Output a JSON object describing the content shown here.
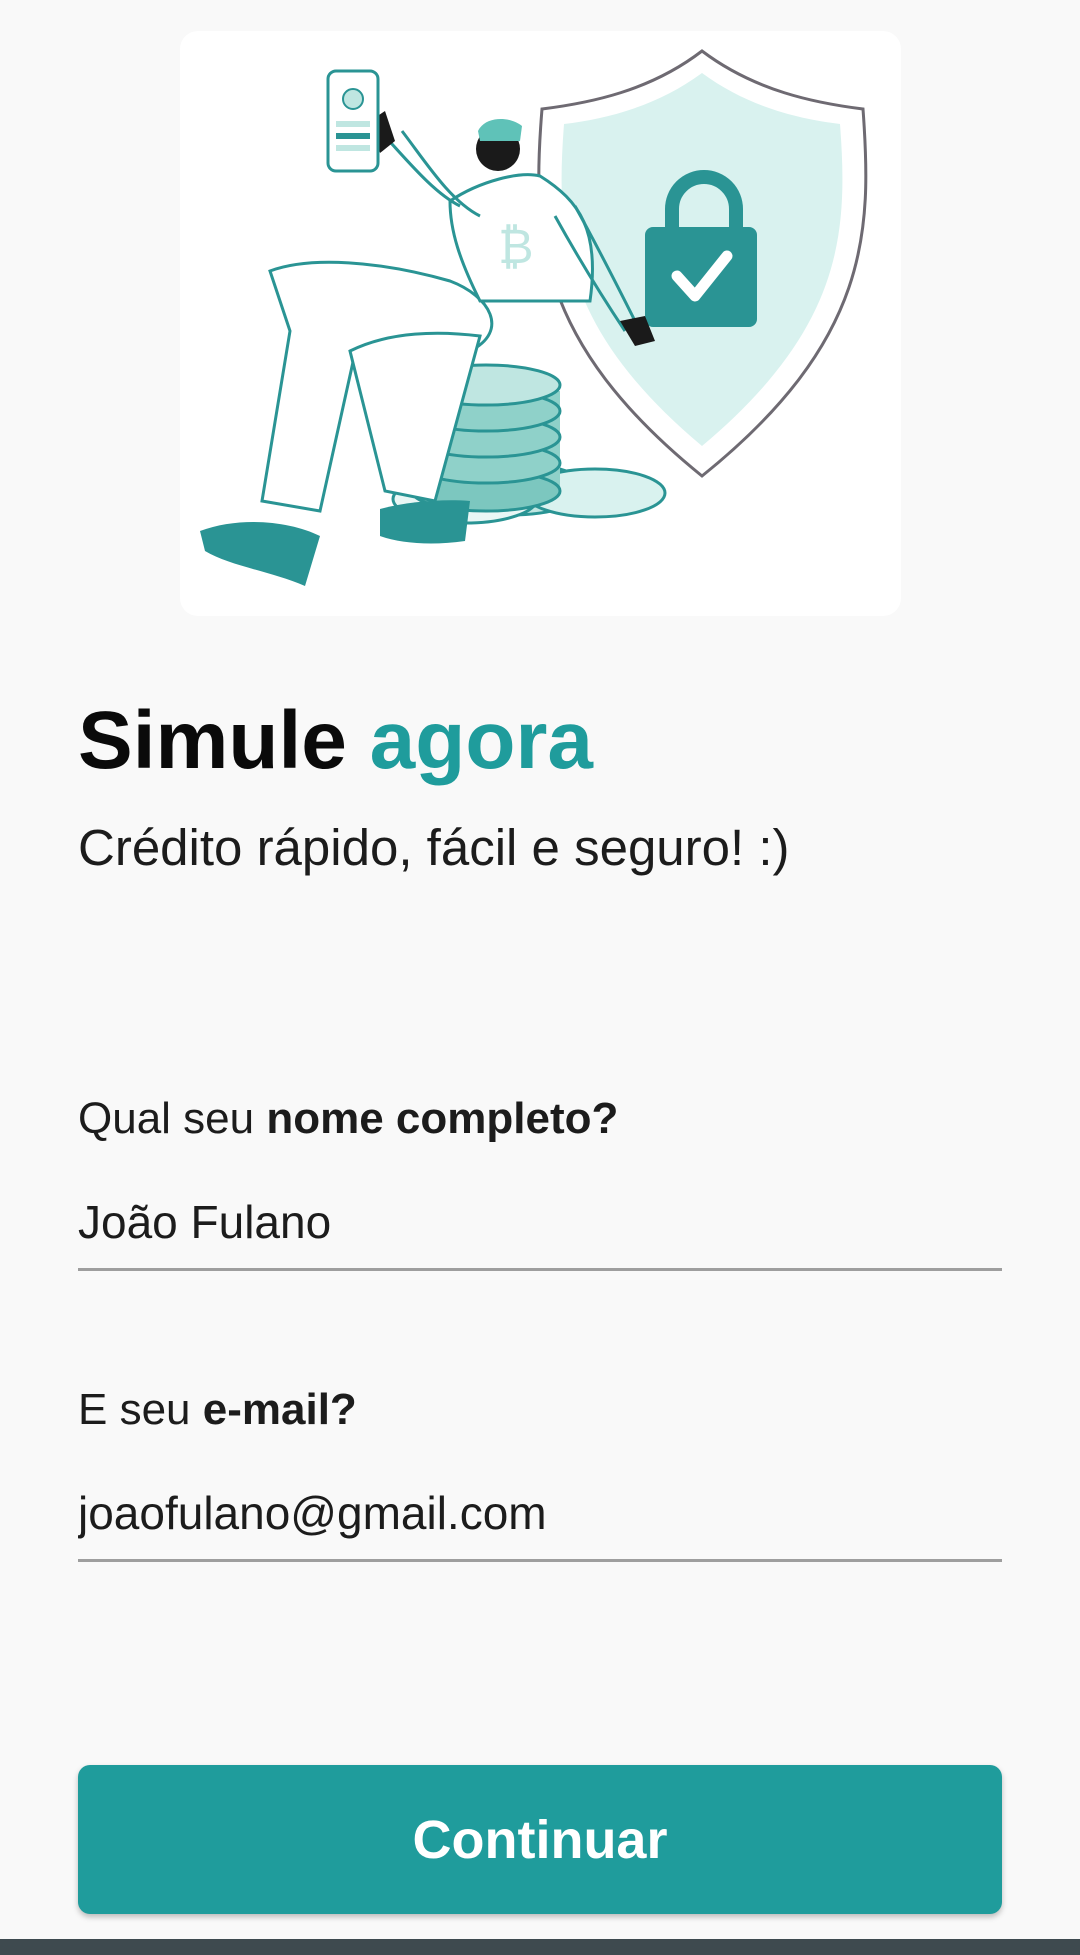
{
  "colors": {
    "accent": "#1f9c9c",
    "background": "#f9f9f9",
    "nav_bar": "#3e4a4f"
  },
  "hero": {
    "icons": [
      "shield-icon",
      "padlock-check-icon",
      "coin-stack-icon",
      "phone-icon",
      "bitcoin-icon"
    ]
  },
  "headline": {
    "main": "Simule",
    "accent": "agora"
  },
  "subtitle": "Crédito rápido, fácil e seguro! :)",
  "form": {
    "name": {
      "label_prefix": "Qual seu",
      "label_bold": "nome completo?",
      "value": "João Fulano"
    },
    "email": {
      "label_prefix": "E seu",
      "label_bold": "e-mail?",
      "value": "joaofulano@gmail.com"
    }
  },
  "actions": {
    "continue_label": "Continuar"
  }
}
